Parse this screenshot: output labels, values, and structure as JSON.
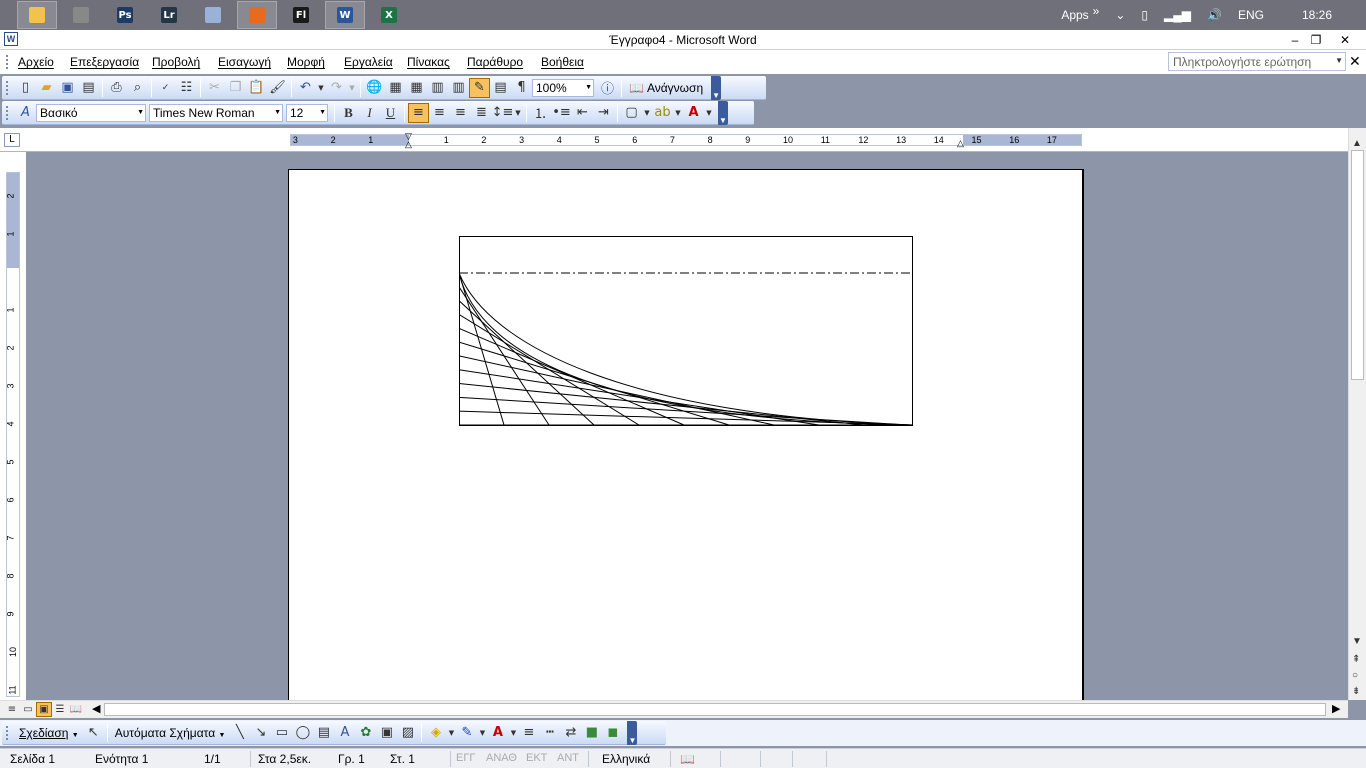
{
  "taskbar": {
    "apps": [
      {
        "name": "file-explorer",
        "label": "",
        "color": "#f2c24f",
        "active": true
      },
      {
        "name": "capture-tool",
        "label": "",
        "color": "#888888",
        "active": false
      },
      {
        "name": "photoshop",
        "label": "Ps",
        "color": "#1e3b66",
        "active": false
      },
      {
        "name": "lightroom",
        "label": "Lr",
        "color": "#243547",
        "active": false
      },
      {
        "name": "calculator",
        "label": "",
        "color": "#9ab2d8",
        "active": false
      },
      {
        "name": "firefox",
        "label": "",
        "color": "#e76a1f",
        "active": true
      },
      {
        "name": "flash",
        "label": "Fl",
        "color": "#1a1a1a",
        "active": false
      },
      {
        "name": "word",
        "label": "W",
        "color": "#2b579a",
        "active": true
      },
      {
        "name": "excel",
        "label": "X",
        "color": "#1f7244",
        "active": false
      }
    ],
    "tray": {
      "apps_label": "Apps",
      "chevron": "»",
      "language": "ENG",
      "time": "18:26"
    }
  },
  "titlebar": {
    "title": "Έγγραφο4 - Microsoft Word",
    "minimize": "‒",
    "restore": "❐",
    "close": "✕"
  },
  "menubar": {
    "items": [
      "Αρχείο",
      "Επεξεργασία",
      "Προβολή",
      "Εισαγωγή",
      "Μορφή",
      "Εργαλεία",
      "Πίνακας",
      "Παράθυρο",
      "Βοήθεια"
    ],
    "ask_placeholder": "Πληκτρολογήστε ερώτηση",
    "doc_close": "✕"
  },
  "standard_toolbar": {
    "zoom": "100%",
    "read_label": "Ανάγνωση"
  },
  "format_toolbar": {
    "style": "Βασικό",
    "font": "Times New Roman",
    "size": "12",
    "bold": "B",
    "italic": "I",
    "underline": "U"
  },
  "ruler": {
    "horizontal_labels": [
      "3",
      "2",
      "1",
      "",
      "1",
      "2",
      "3",
      "4",
      "5",
      "6",
      "7",
      "8",
      "9",
      "10",
      "11",
      "12",
      "13",
      "14",
      "15",
      "16",
      "17"
    ],
    "vertical_labels": [
      "2",
      "1",
      "",
      "1",
      "2",
      "3",
      "4",
      "5",
      "6",
      "7",
      "8",
      "9",
      "10",
      "11"
    ],
    "tab_selector": "L"
  },
  "drawing_toolbar": {
    "draw_label": "Σχεδίαση",
    "autoshapes_label": "Αυτόματα Σχήματα"
  },
  "statusbar": {
    "page": "Σελίδα 1",
    "section": "Ενότητα 1",
    "pages": "1/1",
    "at": "Στα 2,5εκ.",
    "line": "Γρ. 1",
    "column": "Στ. 1",
    "rec": "ΕΓΓ",
    "trk": "ΑΝΑΘ",
    "ext": "ΕΚΤ",
    "ovr": "ΑΝΤ",
    "language": "Ελληνικά"
  }
}
